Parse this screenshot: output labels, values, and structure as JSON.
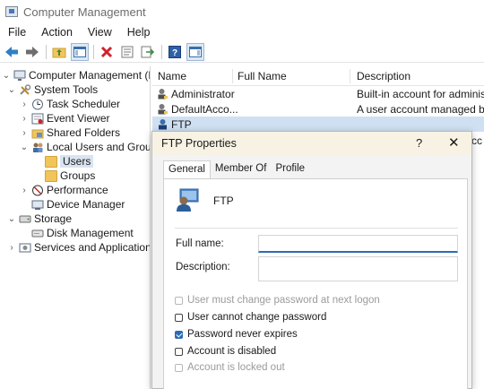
{
  "window": {
    "title": "Computer Management",
    "icon": "computer-management-icon"
  },
  "menu": [
    "File",
    "Action",
    "View",
    "Help"
  ],
  "toolbar": {
    "buttons": [
      "back-icon",
      "forward-icon",
      "up-folder-icon",
      "show-hide-tree-icon",
      "delete-icon",
      "properties-icon",
      "export-icon",
      "help-icon",
      "show-hide-action-pane-icon"
    ]
  },
  "tree": {
    "items": [
      {
        "label": "Computer Management (Local",
        "icon": "computer-management-icon",
        "expanded": true
      },
      {
        "label": "System Tools",
        "icon": "tools-icon",
        "expanded": true
      },
      {
        "label": "Task Scheduler",
        "icon": "clock-icon",
        "expanded": false
      },
      {
        "label": "Event Viewer",
        "icon": "event-viewer-icon",
        "expanded": false
      },
      {
        "label": "Shared Folders",
        "icon": "shared-folder-icon",
        "expanded": false
      },
      {
        "label": "Local Users and Groups",
        "icon": "users-icon",
        "expanded": true
      },
      {
        "label": "Users",
        "icon": "folder-icon",
        "selected": true
      },
      {
        "label": "Groups",
        "icon": "folder-icon"
      },
      {
        "label": "Performance",
        "icon": "performance-icon",
        "expanded": false
      },
      {
        "label": "Device Manager",
        "icon": "device-manager-icon"
      },
      {
        "label": "Storage",
        "icon": "storage-icon",
        "expanded": true
      },
      {
        "label": "Disk Management",
        "icon": "disk-icon"
      },
      {
        "label": "Services and Applications",
        "icon": "services-icon",
        "expanded": false
      }
    ]
  },
  "list": {
    "columns": [
      "Name",
      "Full Name",
      "Description"
    ],
    "rows": [
      {
        "name": "Administrator",
        "description": "Built-in account for administer"
      },
      {
        "name": "DefaultAcco...",
        "description": "A user account managed by th"
      },
      {
        "name": "FTP",
        "description": ""
      }
    ],
    "overflow_fragment": "ccc"
  },
  "dialog": {
    "title": "FTP Properties",
    "help_label": "?",
    "close_label": "✕",
    "tabs": [
      "General",
      "Member Of",
      "Profile"
    ],
    "active_tab": "General",
    "user_name": "FTP",
    "full_name_label": "Full name:",
    "full_name_value": "",
    "description_label": "Description:",
    "description_value": "",
    "checkboxes": [
      {
        "label": "User must change password at next logon",
        "checked": false,
        "disabled": true
      },
      {
        "label": "User cannot change password",
        "checked": false,
        "disabled": false
      },
      {
        "label": "Password never expires",
        "checked": true,
        "disabled": false
      },
      {
        "label": "Account is disabled",
        "checked": false,
        "disabled": false
      },
      {
        "label": "Account is locked out",
        "checked": false,
        "disabled": true
      }
    ]
  },
  "colors": {
    "accent": "#2b6cb3",
    "selection": "#d9e4f1",
    "dialog_title_bg": "#f7f2e3"
  }
}
